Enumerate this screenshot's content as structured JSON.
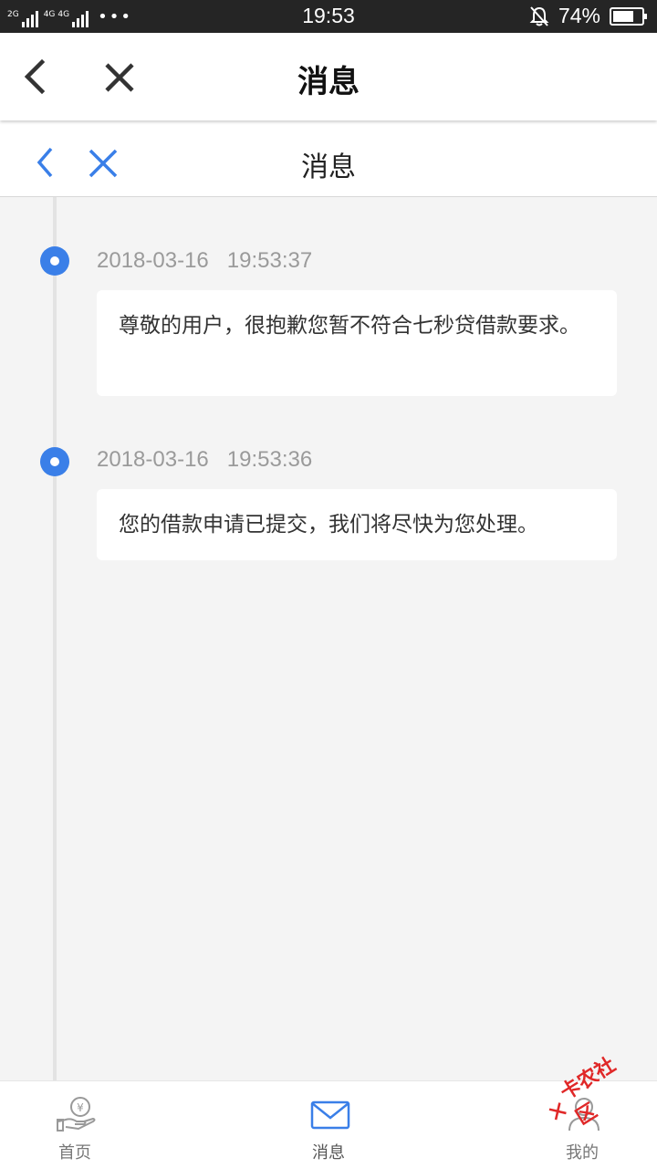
{
  "status_bar": {
    "network_labels": [
      "2G",
      "4G",
      "4G"
    ],
    "time": "19:53",
    "battery_percent": "74%",
    "battery_level": 0.74,
    "icons": [
      "signal-icon",
      "more-dots-icon",
      "silent-bell-icon",
      "battery-icon"
    ]
  },
  "header_outer": {
    "title": "消息",
    "back_icon": "chevron-left-icon",
    "close_icon": "close-icon"
  },
  "header_inner": {
    "title": "消息",
    "back_icon": "chevron-left-icon",
    "close_icon": "close-icon",
    "accent_color": "#3a7fe8"
  },
  "messages": [
    {
      "date": "2018-03-16",
      "time": "19:53:37",
      "text": "尊敬的用户，很抱歉您暂不符合七秒贷借款要求。"
    },
    {
      "date": "2018-03-16",
      "time": "19:53:36",
      "text": "您的借款申请已提交，我们将尽快为您处理。"
    }
  ],
  "tabbar": {
    "tabs": [
      {
        "label": "首页",
        "icon": "hand-coin-icon"
      },
      {
        "label": "消息",
        "icon": "envelope-icon",
        "active": true
      },
      {
        "label": "我的",
        "icon": "user-icon"
      }
    ]
  },
  "watermark": {
    "text": "卡农社区"
  },
  "colors": {
    "accent": "#3a7fe8",
    "background": "#f4f4f4",
    "status_bar": "#252525"
  }
}
